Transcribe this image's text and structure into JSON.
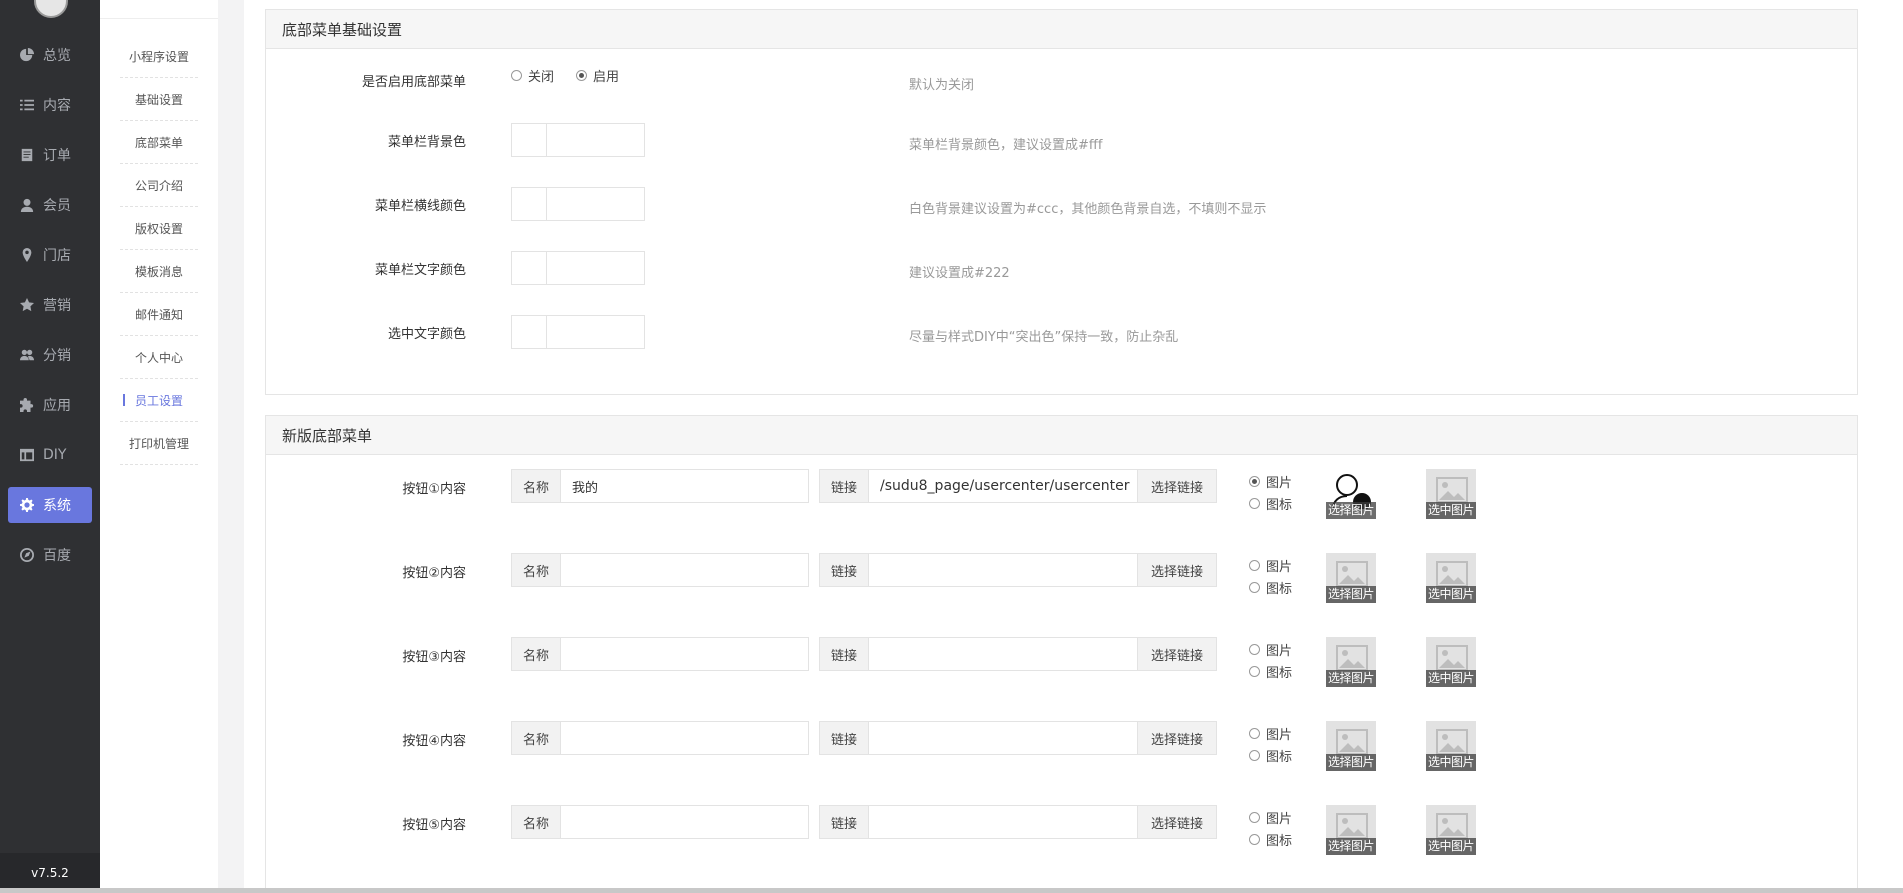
{
  "sidebar": {
    "items": [
      {
        "label": "总览",
        "icon": "pie-chart-icon"
      },
      {
        "label": "内容",
        "icon": "list-icon"
      },
      {
        "label": "订单",
        "icon": "book-icon"
      },
      {
        "label": "会员",
        "icon": "user-icon"
      },
      {
        "label": "门店",
        "icon": "map-pin-icon"
      },
      {
        "label": "营销",
        "icon": "star-icon"
      },
      {
        "label": "分销",
        "icon": "users-icon"
      },
      {
        "label": "应用",
        "icon": "puzzle-icon"
      },
      {
        "label": "DIY",
        "icon": "layout-icon"
      },
      {
        "label": "系统",
        "icon": "gear-icon",
        "active": true
      },
      {
        "label": "百度",
        "icon": "compass-icon"
      }
    ],
    "version": "v7.5.2",
    "active_color": "#6977de"
  },
  "submenu": {
    "items": [
      {
        "label": "小程序设置"
      },
      {
        "label": "基础设置"
      },
      {
        "label": "底部菜单"
      },
      {
        "label": "公司介绍"
      },
      {
        "label": "版权设置"
      },
      {
        "label": "模板消息"
      },
      {
        "label": "邮件通知"
      },
      {
        "label": "个人中心"
      },
      {
        "label": "员工设置",
        "active": true
      },
      {
        "label": "打印机管理"
      }
    ]
  },
  "basic_panel": {
    "title": "底部菜单基础设置",
    "enable": {
      "label": "是否启用底部菜单",
      "options": [
        "关闭",
        "启用"
      ],
      "selected": "启用",
      "hint": "默认为关闭"
    },
    "fields": [
      {
        "label": "菜单栏背景色",
        "hint": "菜单栏背景颜色，建议设置成#fff"
      },
      {
        "label": "菜单栏横线颜色",
        "hint": "白色背景建议设置为#ccc，其他颜色背景自选，不填则不显示"
      },
      {
        "label": "菜单栏文字颜色",
        "hint": "建议设置成#222"
      },
      {
        "label": "选中文字颜色",
        "hint": "尽量与样式DIY中“突出色”保持一致，防止杂乱"
      }
    ]
  },
  "new_panel": {
    "title": "新版底部菜单",
    "name_addon": "名称",
    "link_addon": "链接",
    "choose_link": "选择链接",
    "type_options": [
      "图片",
      "图标"
    ],
    "choose_image": "选择图片",
    "selected_image": "选中图片",
    "buttons": [
      {
        "label": "按钮①内容",
        "name": "我的",
        "link": "/sudu8_page/usercenter/usercenter",
        "type": "图片"
      },
      {
        "label": "按钮②内容",
        "name": "",
        "link": "",
        "type": ""
      },
      {
        "label": "按钮③内容",
        "name": "",
        "link": "",
        "type": ""
      },
      {
        "label": "按钮④内容",
        "name": "",
        "link": "",
        "type": ""
      },
      {
        "label": "按钮⑤内容",
        "name": "",
        "link": "",
        "type": ""
      }
    ]
  }
}
